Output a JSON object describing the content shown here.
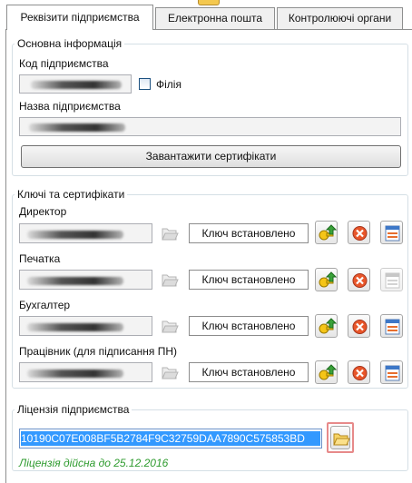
{
  "tabs": [
    {
      "label": "Реквізити підприємства",
      "active": true
    },
    {
      "label": "Електронна пошта",
      "active": false
    },
    {
      "label": "Контролюючі органи",
      "active": false
    }
  ],
  "basic_info": {
    "legend": "Основна інформація",
    "code_label": "Код підприємства",
    "branch_label": "Філія",
    "branch_checked": false,
    "name_label": "Назва підприємства",
    "load_certs_button": "Завантажити сертифікати"
  },
  "keys": {
    "legend": "Ключі та сертифікати",
    "rows": [
      {
        "label": "Директор",
        "status": "Ключ встановлено"
      },
      {
        "label": "Печатка",
        "status": "Ключ встановлено"
      },
      {
        "label": "Бухгалтер",
        "status": "Ключ встановлено"
      },
      {
        "label": "Працівник (для підписання ПН)",
        "status": "Ключ встановлено"
      }
    ]
  },
  "license": {
    "legend": "Ліцензія підприємства",
    "key": "10190C07E008BF5B2784F9C32759DAA7890C575853BD",
    "validity": "Ліцензія дійсна до 25.12.2016"
  },
  "colors": {
    "selection": "#3399ff",
    "valid_text": "#2e9b2e",
    "highlight": "#e78a8a"
  }
}
